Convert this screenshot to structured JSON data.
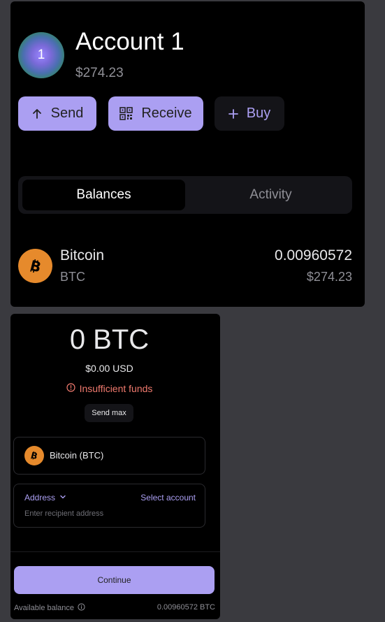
{
  "account": {
    "avatar_text": "1",
    "name": "Account 1",
    "balance": "$274.23"
  },
  "actions": {
    "send_label": "Send",
    "receive_label": "Receive",
    "buy_label": "Buy"
  },
  "tabs": [
    {
      "label": "Balances",
      "active": true
    },
    {
      "label": "Activity",
      "active": false
    }
  ],
  "holdings": [
    {
      "icon": "bitcoin-icon",
      "name": "Bitcoin",
      "symbol": "BTC",
      "amount": "0.00960572",
      "value_usd": "$274.23"
    }
  ],
  "send_form": {
    "amount": "0 BTC",
    "amount_usd": "$0.00 USD",
    "warning": "Insufficient funds",
    "send_max_label": "Send max",
    "token_label": "Bitcoin (BTC)",
    "address_label": "Address",
    "select_account_label": "Select account",
    "address_value": "",
    "address_placeholder": "Enter recipient address",
    "continue_label": "Continue",
    "available_label": "Available balance",
    "available_value": "0.00960572 BTC"
  },
  "colors": {
    "accent": "#ab9ff2",
    "background": "#000000",
    "page_background": "#3a3a3f",
    "bitcoin": "#e68a2c",
    "warning": "#f07a6e",
    "muted_text": "#8f8f96"
  }
}
